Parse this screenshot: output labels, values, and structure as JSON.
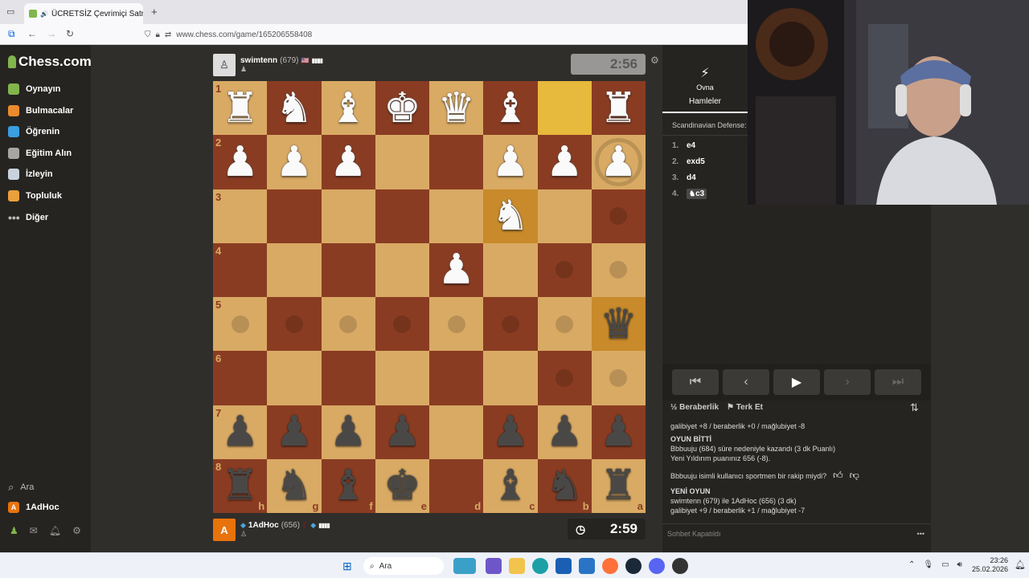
{
  "browser": {
    "tab_title": "ÜCRETSİZ Çevrimiçi Satranç",
    "url": "www.chess.com/game/165206558408"
  },
  "sidebar": {
    "logo": "Chess.com",
    "items": [
      {
        "label": "Oynayın",
        "icon": "play-icon",
        "color": "#81b64c"
      },
      {
        "label": "Bulmacalar",
        "icon": "puzzle-icon",
        "color": "#e98b2d"
      },
      {
        "label": "Öğrenin",
        "icon": "learn-icon",
        "color": "#3a9ee0"
      },
      {
        "label": "Eğitim Alın",
        "icon": "coach-icon",
        "color": "#a7a6a2"
      },
      {
        "label": "İzleyin",
        "icon": "watch-icon",
        "color": "#c9d3dd"
      },
      {
        "label": "Topluluk",
        "icon": "community-icon",
        "color": "#e9a03b"
      },
      {
        "label": "Diğer",
        "icon": "more-icon",
        "color": "#bbb"
      }
    ],
    "search_label": "Ara",
    "user_label": "1AdHoc",
    "user_initial": "A"
  },
  "top_player": {
    "name": "swimtenn",
    "rating": "(679)",
    "clock": "2:56"
  },
  "bottom_player": {
    "name": "1AdHoc",
    "rating": "(656)",
    "initial": "A",
    "clock": "2:59"
  },
  "board": {
    "orientation": "black",
    "ranks": [
      "1",
      "2",
      "3",
      "4",
      "5",
      "6",
      "7",
      "8"
    ],
    "files": [
      "h",
      "g",
      "f",
      "e",
      "d",
      "c",
      "b",
      "a"
    ],
    "rows": [
      [
        "wR",
        "wN",
        "wB",
        "wK",
        "wQ",
        "wB",
        "",
        "wR"
      ],
      [
        "wP",
        "wP",
        "wP",
        "",
        "",
        "wP",
        "wP",
        "wP"
      ],
      [
        "",
        "",
        "",
        "",
        "",
        "wN",
        "",
        ""
      ],
      [
        "",
        "",
        "",
        "",
        "wP",
        "",
        "",
        ""
      ],
      [
        "",
        "",
        "",
        "",
        "",
        "",
        "",
        "bQ"
      ],
      [
        "",
        "",
        "",
        "",
        "",
        "",
        "",
        ""
      ],
      [
        "bP",
        "bP",
        "bP",
        "bP",
        "",
        "bP",
        "bP",
        "bP"
      ],
      [
        "bR",
        "bN",
        "bB",
        "bK",
        "",
        "bB",
        "bN",
        "bR"
      ]
    ],
    "highlights": {
      "0-6": "hl",
      "2-5": "hl2",
      "4-7": "hl2"
    },
    "move_dots": [
      "3-6",
      "3-7",
      "4-0",
      "4-1",
      "4-2",
      "4-3",
      "4-4",
      "4-5",
      "4-6",
      "5-6",
      "5-7",
      "2-7"
    ],
    "ring": [
      "1-7"
    ]
  },
  "right_panel": {
    "tab_play": "Ovna",
    "tab_moves": "Hamleler",
    "opening": "Scandinavian Defense: M",
    "moves": [
      {
        "n": "1.",
        "san": "e4"
      },
      {
        "n": "2.",
        "san": "exd5"
      },
      {
        "n": "3.",
        "san": "d4"
      },
      {
        "n": "4.",
        "san": "c3"
      }
    ],
    "draw_label": "Beraberlik",
    "resign_label": "Terk Et",
    "chat": [
      {
        "text": "galibiyet +8 / beraberlik +0 / mağlubiyet -8",
        "bold": false
      },
      {
        "text": "OYUN BİTTİ",
        "bold": true
      },
      {
        "text": "Bbbuuju (684) süre nedeniyle kazandı (3 dk Puanlı)",
        "bold": false
      },
      {
        "text": "Yeni Yıldırım puanınız 656 (-8).",
        "bold": false
      },
      {
        "text": "Bbbuuju isimli kullanıcı sportmen bir rakip miydi?",
        "bold": false
      },
      {
        "text": "YENİ OYUN",
        "bold": true
      },
      {
        "text": "swimtenn (679) ile 1AdHoc (656) (3 dk)",
        "bold": false
      },
      {
        "text": "galibiyet +9 / beraberlik +1 / mağlubiyet -7",
        "bold": false
      }
    ],
    "chat_closed": "Sohbet Kapatıldı"
  },
  "taskbar": {
    "search": "Ara",
    "time": "23:26",
    "date": "25.02.2026"
  }
}
